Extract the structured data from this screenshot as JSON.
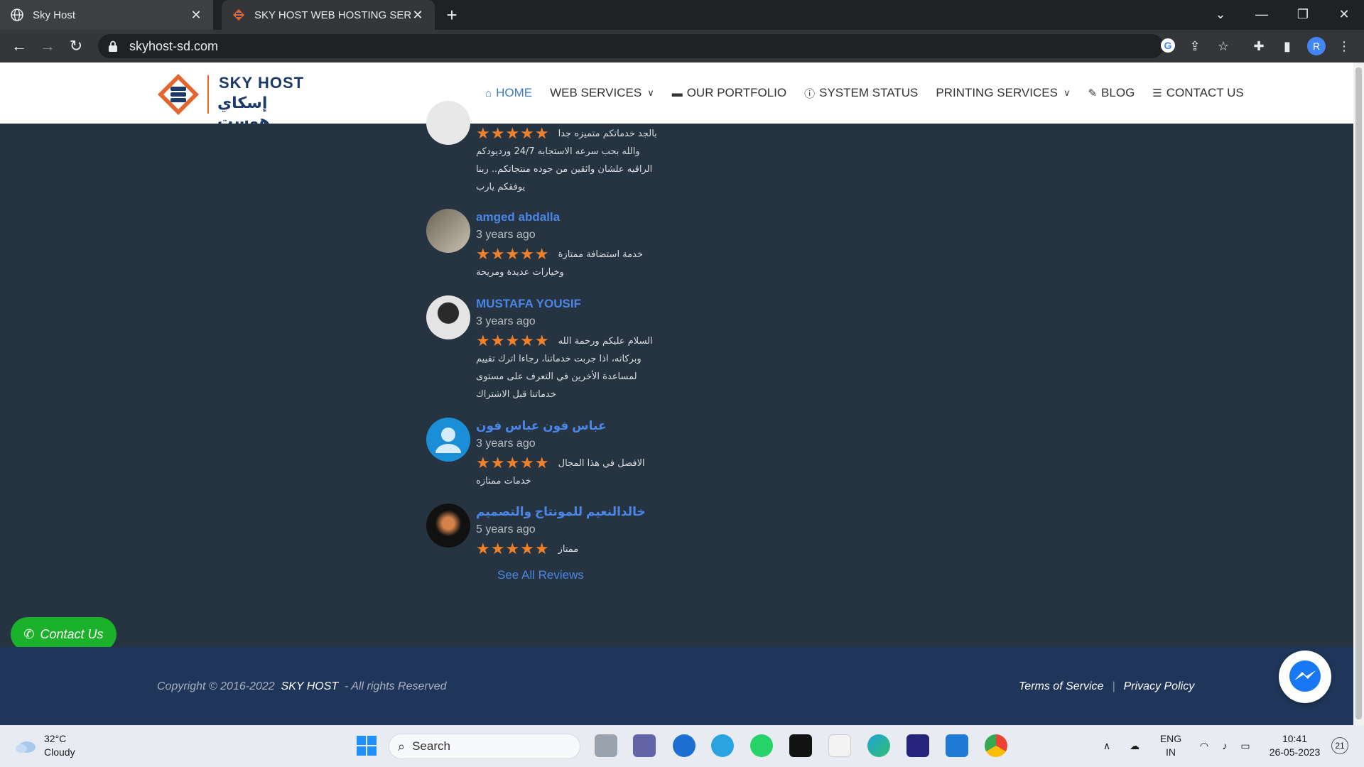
{
  "browser": {
    "tabs": [
      {
        "title": "Sky Host",
        "active": false
      },
      {
        "title": "SKY HOST WEB HOSTING SERVIC",
        "active": true
      }
    ],
    "url": "skyhost-sd.com",
    "profile_initial": "R"
  },
  "site": {
    "logo": {
      "en": "SKY HOST",
      "ar": "إسكاي هوست"
    },
    "nav": [
      {
        "label": "HOME",
        "icon": "home-icon",
        "active": true,
        "dropdown": false
      },
      {
        "label": "WEB SERVICES",
        "icon": "",
        "active": false,
        "dropdown": true
      },
      {
        "label": "OUR PORTFOLIO",
        "icon": "folder-icon",
        "active": false,
        "dropdown": false
      },
      {
        "label": "SYSTEM STATUS",
        "icon": "info-icon",
        "active": false,
        "dropdown": false
      },
      {
        "label": "PRINTING SERVICES",
        "icon": "",
        "active": false,
        "dropdown": true
      },
      {
        "label": "BLOG",
        "icon": "edit-icon",
        "active": false,
        "dropdown": false
      },
      {
        "label": "CONTACT US",
        "icon": "contact-card-icon",
        "active": false,
        "dropdown": false
      }
    ]
  },
  "reviews": {
    "items": [
      {
        "name": "",
        "time": "",
        "rating": 5,
        "text": "بالجد خدماتكم متميزه جدا والله بحب سرعه الاستجابه 24/7 ورديودكم الراقيه علشان واثقين من جوده منتجاتكم.. ربنا يوفقكم يارب"
      },
      {
        "name": "amged abdalla",
        "time": "3 years ago",
        "rating": 5,
        "text": "خدمة استضافة ممتازة وخيارات عديدة ومريحة"
      },
      {
        "name": "MUSTAFA YOUSIF",
        "time": "3 years ago",
        "rating": 5,
        "text": "السلام عليكم ورحمة الله وبركاته، اذا جربت خدماتنا، رجاءا اترك تقييم لمساعدة الأخرين في التعرف على مستوى خدماتنا قبل الاشتراك"
      },
      {
        "name": "عباس فون عباس فون",
        "time": "3 years ago",
        "rating": 5,
        "text": "الافضل في هذا المجال خدمات ممتازه"
      },
      {
        "name": "خالدالنعيم للمونتاج والتصميم",
        "time": "5 years ago",
        "rating": 5,
        "text": "ممتاز"
      }
    ],
    "see_all": "See All Reviews"
  },
  "contact_button": "Contact Us",
  "footer": {
    "copyright_prefix": "Copyright © 2016-2022",
    "brand": "SKY HOST",
    "rights": "- All rights Reserved",
    "terms": "Terms of Service",
    "sep": "|",
    "privacy": "Privacy Policy"
  },
  "taskbar": {
    "weather_temp": "32°C",
    "weather_desc": "Cloudy",
    "search_placeholder": "Search",
    "lang_1": "ENG",
    "lang_2": "IN",
    "time": "10:41",
    "date": "26-05-2023",
    "notifications": "21"
  },
  "colors": {
    "accent_blue": "#4a86e8",
    "star_orange": "#f0812a",
    "page_bg": "#263340",
    "footer_bg": "#1f3559",
    "whatsapp_green": "#1bb12a"
  }
}
